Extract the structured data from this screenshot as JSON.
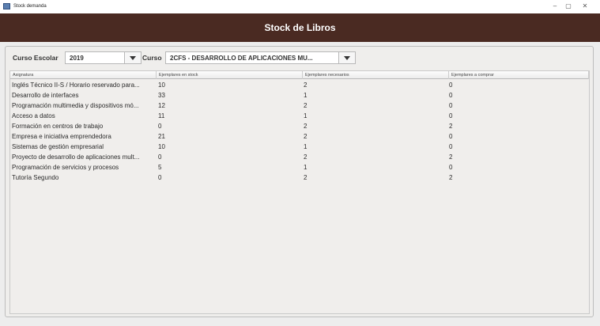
{
  "window": {
    "title": "Stock demanda",
    "controls": {
      "minimize": "–",
      "maximize": "▢",
      "close": "✕"
    }
  },
  "header": {
    "title": "Stock de Libros"
  },
  "filters": {
    "curso_escolar_label": "Curso Escolar",
    "curso_escolar_value": "2019",
    "curso_label": "Curso",
    "curso_value": "2CFS - DESARROLLO DE APLICACIONES MU..."
  },
  "table": {
    "columns": [
      "Asignatura",
      "Ejemplares en stock",
      "Ejemplares necesarios",
      "Ejemplares a comprar"
    ],
    "rows": [
      [
        "Inglés Técnico II-S / Horario reservado para...",
        "10",
        "2",
        "0"
      ],
      [
        "Desarrollo de interfaces",
        "33",
        "1",
        "0"
      ],
      [
        "Programación multimedia y dispositivos mó...",
        "12",
        "2",
        "0"
      ],
      [
        "Acceso a datos",
        "11",
        "1",
        "0"
      ],
      [
        "Formación en centros de trabajo",
        "0",
        "2",
        "2"
      ],
      [
        "Empresa e iniciativa emprendedora",
        "21",
        "2",
        "0"
      ],
      [
        "Sistemas de gestión empresarial",
        "10",
        "1",
        "0"
      ],
      [
        "Proyecto de desarrollo de aplicaciones mult...",
        "0",
        "2",
        "2"
      ],
      [
        "Programación de servicios y procesos",
        "5",
        "1",
        "0"
      ],
      [
        "Tutoría Segundo",
        "0",
        "2",
        "2"
      ]
    ]
  },
  "colors": {
    "header_bg": "#4a2a22",
    "header_text": "#ffffff",
    "panel_bg": "#efeeec"
  }
}
